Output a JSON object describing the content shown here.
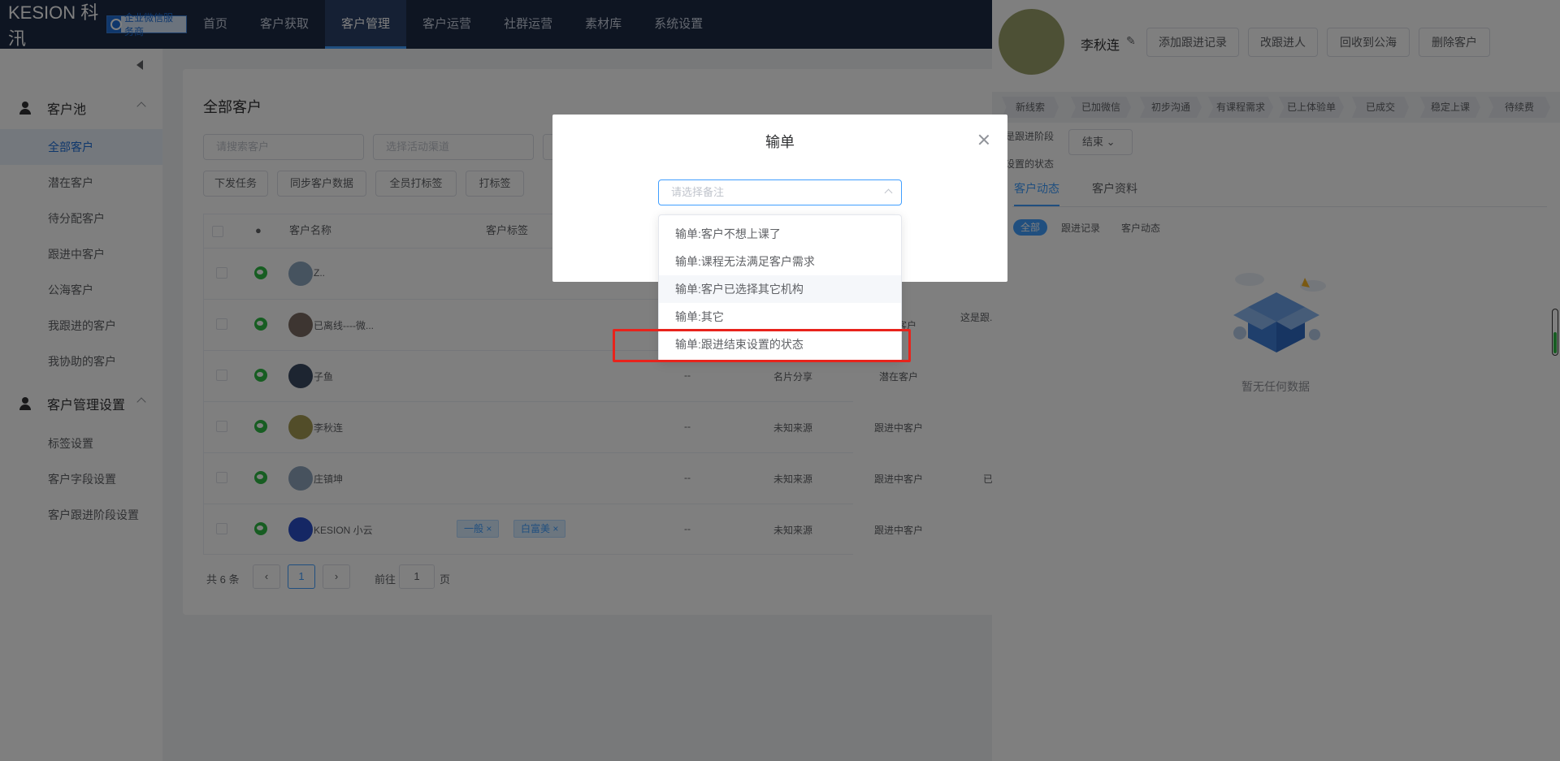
{
  "nav": {
    "logo": "KESION 科汛",
    "badge": "企业微信服务商",
    "items": [
      "首页",
      "客户获取",
      "客户管理",
      "客户运营",
      "社群运营",
      "素材库",
      "系统设置"
    ],
    "active_index": 2
  },
  "sidebar": {
    "groups": [
      {
        "title": "客户池",
        "items": [
          "全部客户",
          "潜在客户",
          "待分配客户",
          "跟进中客户",
          "公海客户",
          "我跟进的客户",
          "我协助的客户"
        ]
      },
      {
        "title": "客户管理设置",
        "items": [
          "标签设置",
          "客户字段设置",
          "客户跟进阶段设置"
        ]
      }
    ],
    "active_item": "全部客户"
  },
  "main": {
    "title": "全部客户",
    "search_placeholder": "请搜索客户",
    "channel_placeholder": "选择活动渠道",
    "buttons": [
      "下发任务",
      "同步客户数据",
      "全员打标签",
      "打标签"
    ],
    "columns": [
      "客户名称",
      "客户标签"
    ],
    "rows": [
      {
        "name": "Z..",
        "c1": "",
        "c2": "",
        "c3": "",
        "c4": ""
      },
      {
        "name": "已离线----微...",
        "c1": "",
        "c2": "",
        "c3": "潜在客户",
        "c4": "这是跟..."
      },
      {
        "name": "子鱼",
        "c1": "--",
        "c2": "名片分享",
        "c3": "潜在客户",
        "c4": ""
      },
      {
        "name": "李秋连",
        "c1": "--",
        "c2": "未知来源",
        "c3": "跟进中客户",
        "c4": ""
      },
      {
        "name": "庄镇坤",
        "c1": "--",
        "c2": "未知来源",
        "c3": "跟进中客户",
        "c4": "已..."
      },
      {
        "name": "KESION 小云",
        "c1": "--",
        "c2": "未知来源",
        "c3": "跟进中客户",
        "c4": "",
        "tags": [
          "一般",
          "白富美"
        ]
      }
    ],
    "pagination": {
      "total": "共 6 条",
      "current": "1",
      "goto_label": "前往",
      "goto_value": "1",
      "page_suffix": "页"
    }
  },
  "modal": {
    "title": "输单",
    "placeholder": "请选择备注",
    "options": [
      "输单:客户不想上课了",
      "输单:课程无法满足客户需求",
      "输单:客户已选择其它机构",
      "输单:其它",
      "输单:跟进结束设置的状态"
    ],
    "hover_index": 2,
    "highlight_index": 4
  },
  "panel": {
    "name": "李秋连",
    "buttons": [
      "添加跟进记录",
      "改跟进人",
      "回收到公海",
      "删除客户"
    ],
    "stages": [
      "新线索",
      "已加微信",
      "初步沟通",
      "有课程需求",
      "已上体验单",
      "已成交",
      "稳定上课",
      "待续费"
    ],
    "stage_label1": "是跟进阶段",
    "stage_label2": "设置的状态",
    "end_select": "结束",
    "tabs": [
      "客户动态",
      "客户资料"
    ],
    "subtabs": [
      "全部",
      "跟进记录",
      "客户动态"
    ],
    "empty_text": "暂无任何数据"
  },
  "colors": {
    "nav_bg": "#1d2b45",
    "accent": "#409eff",
    "highlight_box": "#e8231c"
  }
}
